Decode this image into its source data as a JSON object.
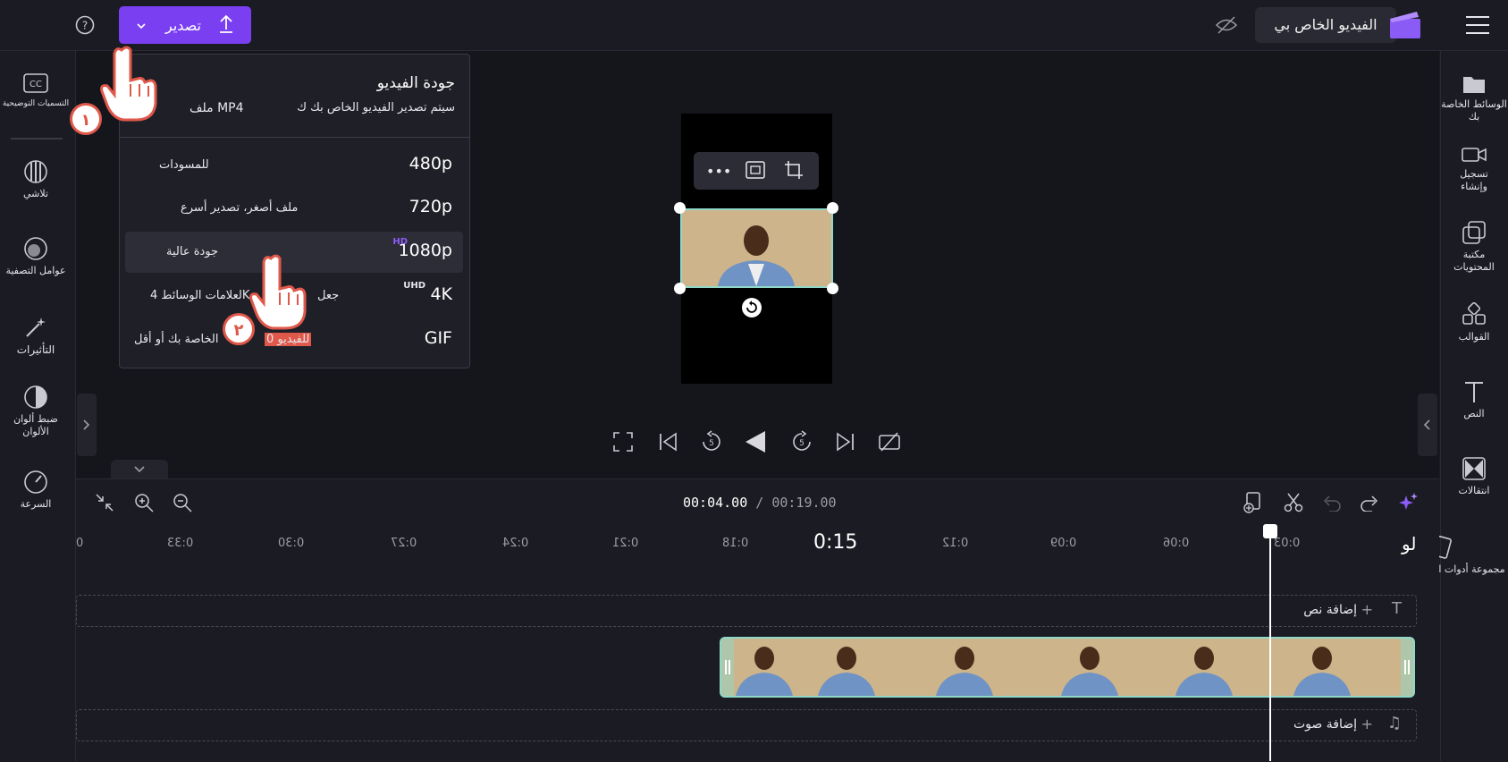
{
  "topbar": {
    "export_label": "تصدير",
    "project_title": "الفيديو الخاص بي"
  },
  "export_menu": {
    "title": "جودة الفيديو",
    "subtitle": "سيتم تصدير الفيديو الخاص بك ك",
    "format": "ملف MP4",
    "options": [
      {
        "name": "480p",
        "desc": "للمسودات",
        "badge": ""
      },
      {
        "name": "720p",
        "desc": "ملف أصغر، تصدير أسرع",
        "badge": ""
      },
      {
        "name": "1080p",
        "desc": "جودة عالية",
        "badge": "HD"
      },
      {
        "name": "4K",
        "desc": "لعلامات الوسائط 4K",
        "desc2": "جعل",
        "badge": "UHD"
      },
      {
        "name": "GIF",
        "desc": "الخاصة بك أو أقل",
        "desc2": "للفيديو 0"
      }
    ]
  },
  "left_sidebar": [
    {
      "label": "التسميات التوضيحية"
    },
    {
      "label": "تلاشي"
    },
    {
      "label": "عوامل التصفية"
    },
    {
      "label": "التأثيرات"
    },
    {
      "label": "ضبط ألوان الألوان"
    },
    {
      "label": "السرعة"
    }
  ],
  "right_sidebar": [
    {
      "label": "الوسائط الخاصة بك"
    },
    {
      "label": "تسجيل وإنشاء"
    },
    {
      "label": "مكتبة المحتويات"
    },
    {
      "label": "القوالب"
    },
    {
      "label": "النص"
    },
    {
      "label": "انتقالات"
    },
    {
      "label": "مجموعة أدوات العلامة التجارية"
    }
  ],
  "timeline": {
    "current_time": "00:04.00",
    "total_time": "00:19.00",
    "ruler": [
      "0:03",
      "0:06",
      "0:09",
      "0:12",
      "0:15",
      "0:18",
      "0:21",
      "0:24",
      "0:27",
      "0:30",
      "0:33",
      "0"
    ],
    "ruler_lead": "لو",
    "add_text": "إضافة نص",
    "add_audio": "إضافة صوت"
  },
  "steps": {
    "one": "١",
    "two": "٢"
  },
  "colors": {
    "accent": "#7b3ff2",
    "clip_border": "#8fd8c8",
    "step": "#e0584a"
  }
}
